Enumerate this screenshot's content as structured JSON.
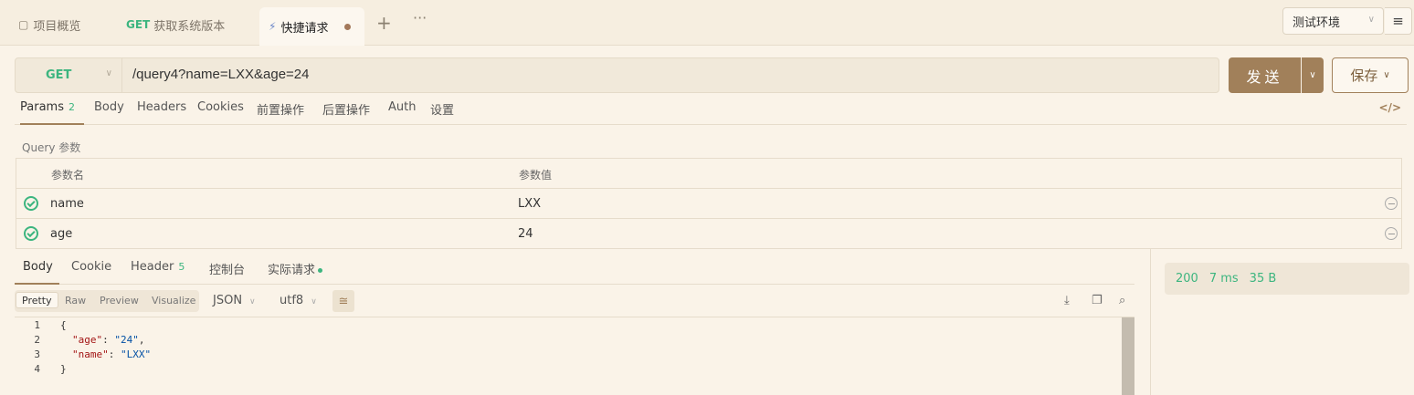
{
  "tabs": [
    {
      "icon": "overview-icon",
      "label": "项目概览"
    },
    {
      "method": "GET",
      "label": "获取系统版本"
    },
    {
      "icon": "lightning-icon",
      "label": "快捷请求",
      "active": true,
      "unsaved": true
    }
  ],
  "environment": {
    "selected": "测试环境"
  },
  "request": {
    "method": "GET",
    "url": "/query4?name=LXX&age=24",
    "send_label": "发送",
    "save_label": "保存"
  },
  "request_tabs": [
    {
      "label": "Params",
      "badge": "2",
      "active": true
    },
    {
      "label": "Body"
    },
    {
      "label": "Headers"
    },
    {
      "label": "Cookies"
    },
    {
      "label": "前置操作"
    },
    {
      "label": "后置操作"
    },
    {
      "label": "Auth"
    },
    {
      "label": "设置"
    }
  ],
  "query": {
    "title": "Query 参数",
    "col_name": "参数名",
    "col_value": "参数值",
    "rows": [
      {
        "name": "name",
        "value": "LXX",
        "enabled": true
      },
      {
        "name": "age",
        "value": "24",
        "enabled": true
      }
    ]
  },
  "response_tabs": [
    {
      "label": "Body",
      "active": true
    },
    {
      "label": "Cookie"
    },
    {
      "label": "Header",
      "badge": "5"
    },
    {
      "label": "控制台"
    },
    {
      "label": "实际请求",
      "dot": true
    }
  ],
  "view_modes": [
    "Pretty",
    "Raw",
    "Preview",
    "Visualize"
  ],
  "format": "JSON",
  "encoding": "utf8",
  "code_lines": [
    {
      "n": "1",
      "text": "{"
    },
    {
      "n": "2",
      "key": "\"age\"",
      "sep": ": ",
      "val": "\"24\"",
      "tail": ","
    },
    {
      "n": "3",
      "key": "\"name\"",
      "sep": ": ",
      "val": "\"LXX\"",
      "tail": ""
    },
    {
      "n": "4",
      "text": "}"
    }
  ],
  "status": {
    "code": "200",
    "time": "7 ms",
    "size": "35 B"
  },
  "colors": {
    "accent": "#a1805a",
    "success": "#3cb57f",
    "background": "#faf3e8"
  }
}
